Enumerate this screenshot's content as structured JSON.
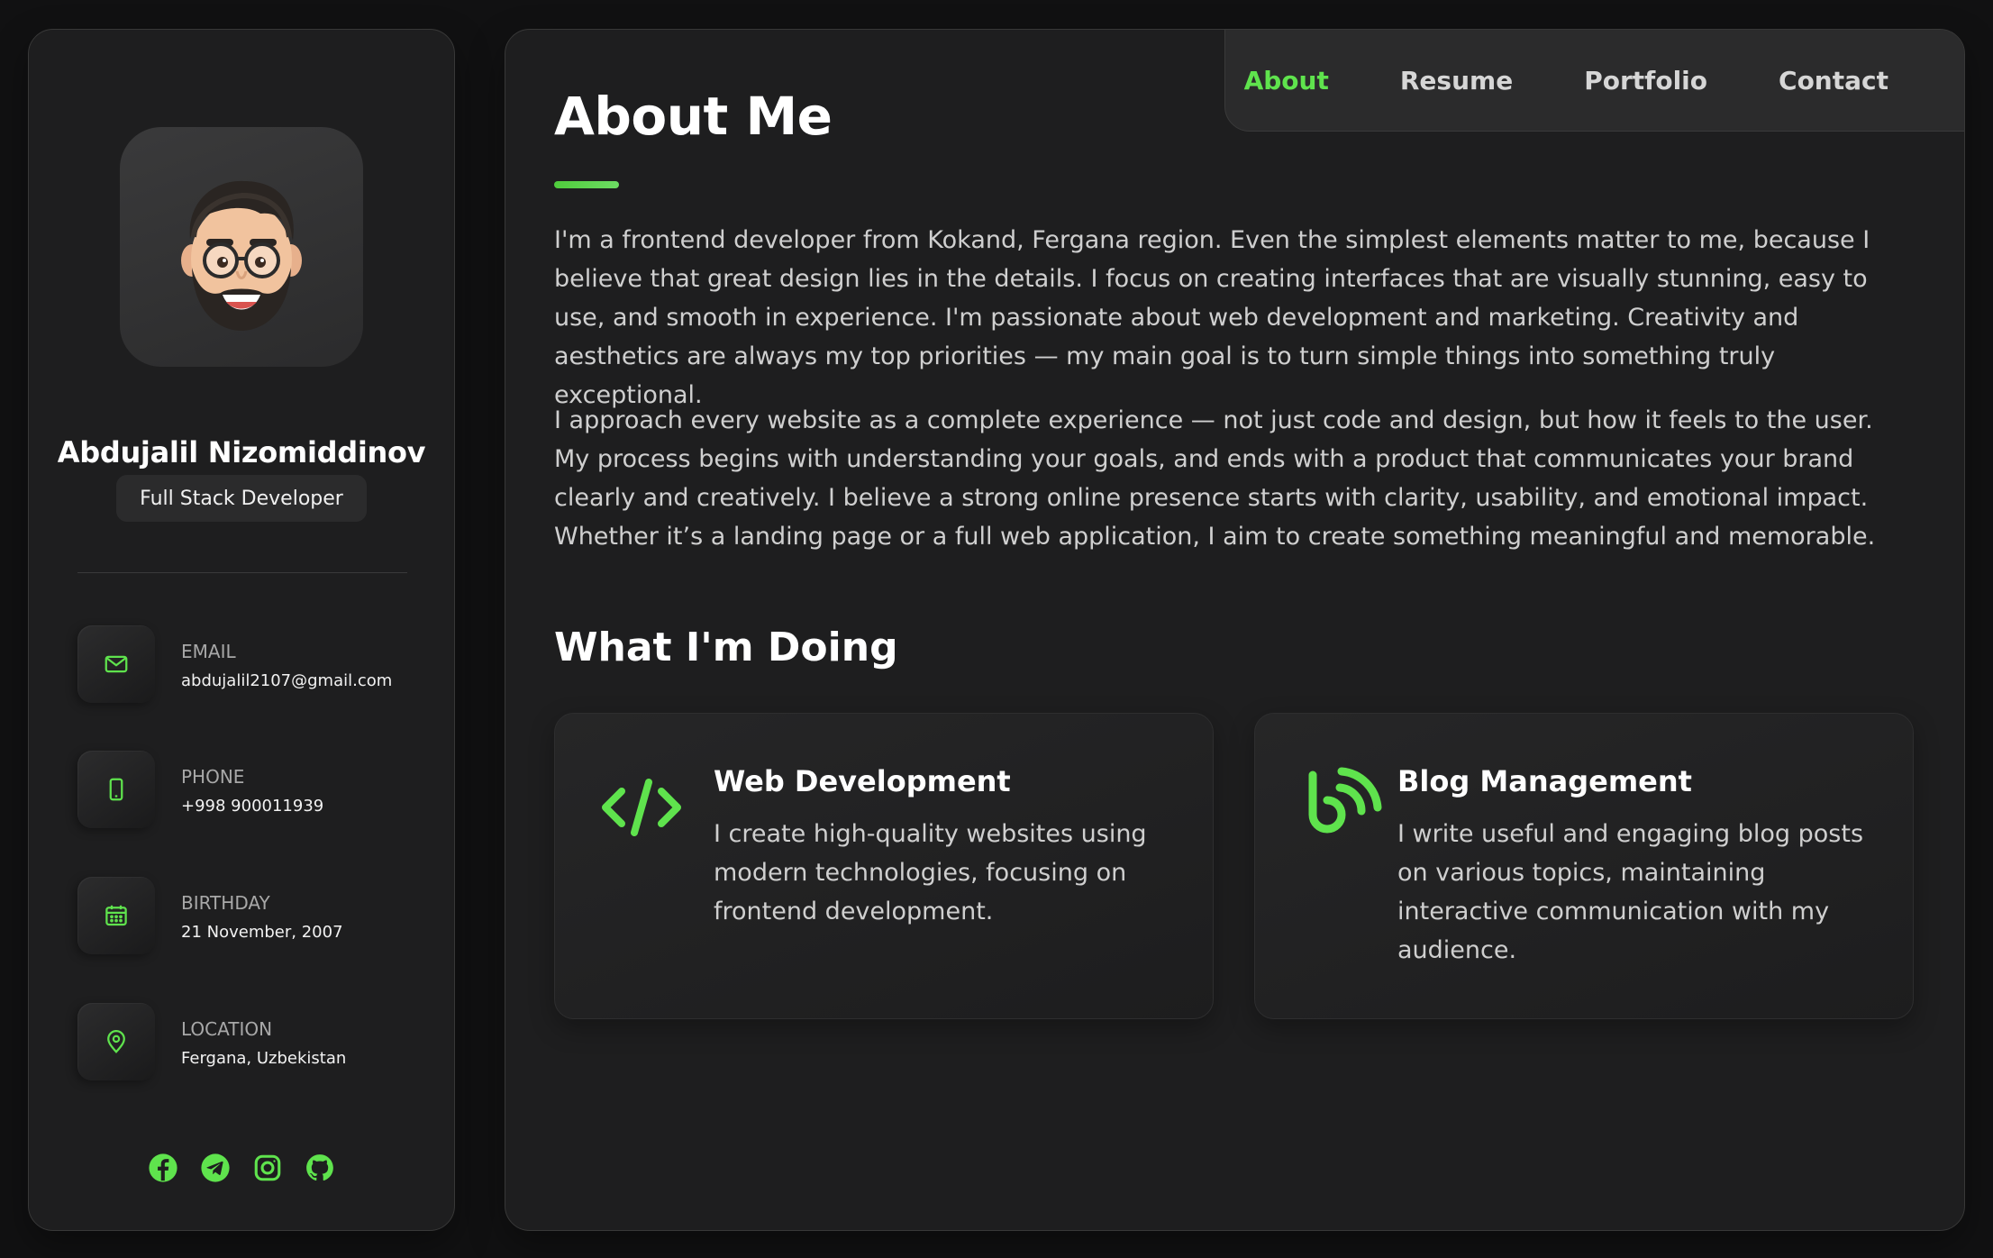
{
  "colors": {
    "accent": "#5fe34d",
    "background": "#111112",
    "panel": "#1e1e1f"
  },
  "profile": {
    "name": "Abdujalil Nizomiddinov",
    "role": "Full Stack Developer",
    "avatar_icon": "memoji-avatar"
  },
  "contacts": [
    {
      "title": "EMAIL",
      "value": "abdujalil2107@gmail.com",
      "icon": "mail-icon"
    },
    {
      "title": "PHONE",
      "value": "+998 900011939",
      "icon": "phone-icon"
    },
    {
      "title": "BIRTHDAY",
      "value": "21 November, 2007",
      "icon": "calendar-icon"
    },
    {
      "title": "LOCATION",
      "value": "Fergana, Uzbekistan",
      "icon": "location-pin-icon"
    }
  ],
  "socials": [
    "facebook-icon",
    "telegram-icon",
    "instagram-icon",
    "github-icon"
  ],
  "nav": {
    "items": [
      "About",
      "Resume",
      "Portfolio",
      "Contact"
    ],
    "active": "About"
  },
  "about": {
    "title": "About Me",
    "paragraphs": [
      "I'm a frontend developer from Kokand, Fergana region. Even the simplest elements matter to me, because I believe that great design lies in the details. I focus on creating interfaces that are visually stunning, easy to use, and smooth in experience. I'm passionate about web development and marketing. Creativity and aesthetics are always my top priorities — my main goal is to turn simple things into something truly exceptional.",
      "I approach every website as a complete experience — not just code and design, but how it feels to the user. My process begins with understanding your goals, and ends with a product that communicates your brand clearly and creatively. I believe a strong online presence starts with clarity, usability, and emotional impact. Whether it’s a landing page or a full web application, I aim to create something meaningful and memorable."
    ]
  },
  "services": {
    "title": "What I'm Doing",
    "items": [
      {
        "title": "Web Development",
        "text": "I create high-quality websites using modern technologies, focusing on frontend development.",
        "icon": "code-icon"
      },
      {
        "title": "Blog Management",
        "text": "I write useful and engaging blog posts on various topics, maintaining interactive communication with my audience.",
        "icon": "blog-icon"
      }
    ]
  }
}
